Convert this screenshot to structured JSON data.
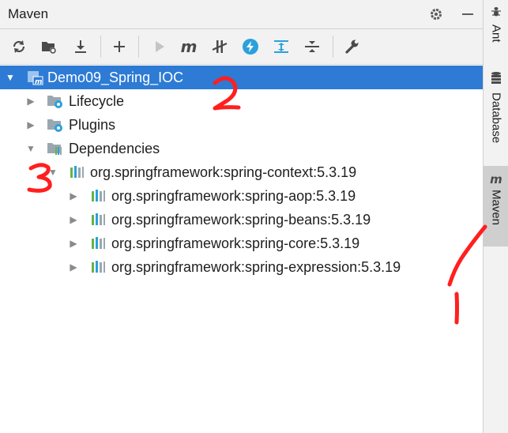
{
  "panel": {
    "title": "Maven",
    "settings_icon": "gear-icon",
    "minimize_icon": "minimize-icon"
  },
  "toolbar": {
    "buttons": [
      {
        "name": "reload-icon"
      },
      {
        "name": "folder-refresh-icon"
      },
      {
        "name": "download-icon"
      },
      {
        "name": "add-icon"
      },
      {
        "name": "run-icon"
      },
      {
        "name": "maven-goal-icon",
        "glyph": "m"
      },
      {
        "name": "skip-tests-icon"
      },
      {
        "name": "offline-lightning-icon"
      },
      {
        "name": "expand-all-icon"
      },
      {
        "name": "collapse-all-icon"
      },
      {
        "name": "wrench-icon"
      }
    ]
  },
  "tree": {
    "root": "Demo09_Spring_IOC",
    "lifecycle": "Lifecycle",
    "plugins": "Plugins",
    "dependencies": "Dependencies",
    "dep_context": "org.springframework:spring-context:5.3.19",
    "dep_aop": "org.springframework:spring-aop:5.3.19",
    "dep_beans": "org.springframework:spring-beans:5.3.19",
    "dep_core": "org.springframework:spring-core:5.3.19",
    "dep_expression": "org.springframework:spring-expression:5.3.19"
  },
  "sidebar": {
    "tabs": [
      {
        "label": "Ant",
        "icon": "ant-icon"
      },
      {
        "label": "Database",
        "icon": "database-icon"
      },
      {
        "label": "Maven",
        "icon": "maven-icon",
        "active": true
      }
    ]
  },
  "annotations": {
    "one": "1",
    "two": "2",
    "three": "3",
    "color": "#ff1f1f"
  },
  "colors": {
    "selection": "#2d7bd5",
    "accent_blue": "#2aa1dc",
    "text": "#1e1e1e"
  }
}
